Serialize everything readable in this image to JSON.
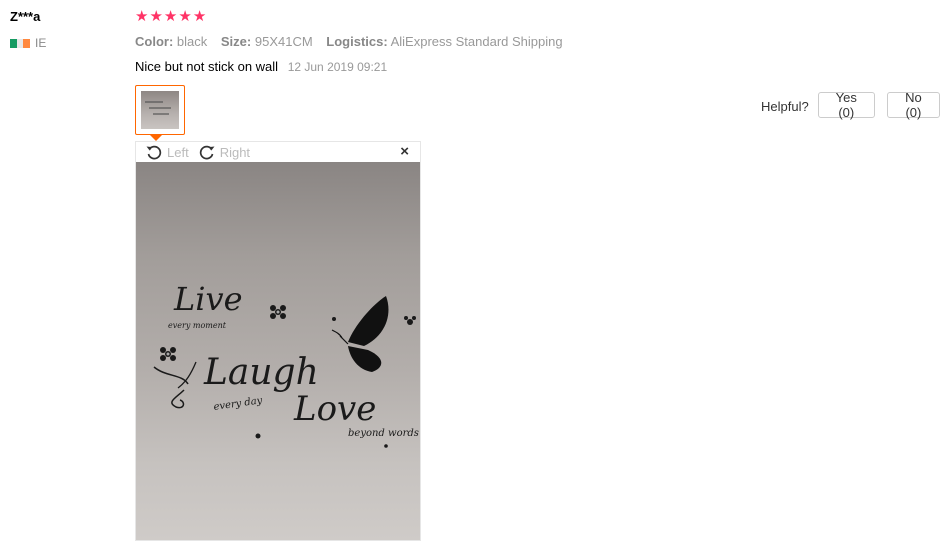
{
  "reviewer": {
    "name": "Z***a",
    "country_code": "IE",
    "flag_colors": [
      "#169b62",
      "#ffffff",
      "#ff883e"
    ]
  },
  "rating": {
    "stars": 5,
    "color": "#f44"
  },
  "attributes": [
    {
      "key": "Color:",
      "value": "black"
    },
    {
      "key": "Size:",
      "value": "95X41CM"
    },
    {
      "key": "Logistics:",
      "value": "AliExpress Standard Shipping"
    }
  ],
  "review": {
    "text": "Nice but not stick on wall",
    "date": "12 Jun 2019 09:21"
  },
  "helpful": {
    "label": "Helpful?",
    "yes_label": "Yes (0)",
    "no_label": "No (0)"
  },
  "viewer": {
    "rotate_left_label": "Left",
    "rotate_right_label": "Right",
    "close_label": "×",
    "accent_color": "#ff6600"
  },
  "wall_decal_text": {
    "live": "Live",
    "live_sub": "every moment",
    "laugh": "Laugh",
    "laugh_sub": "every day",
    "love": "Love",
    "love_sub": "beyond words"
  }
}
